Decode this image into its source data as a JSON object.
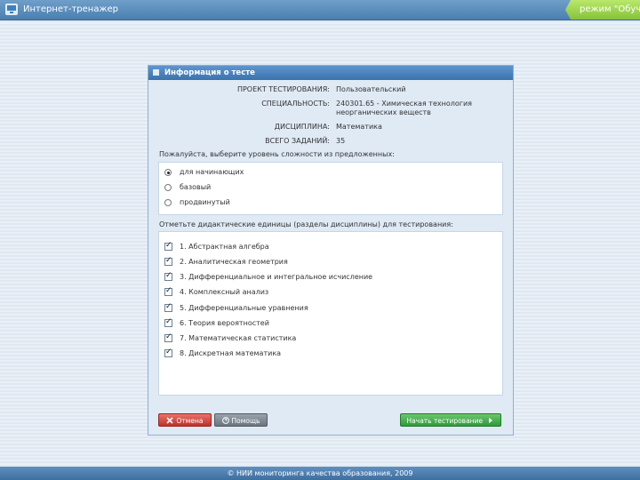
{
  "topbar": {
    "title": "Интернет-тренажер",
    "mode_label": "режим \"Обуче"
  },
  "dialog": {
    "title": "Информация о тесте",
    "info": [
      {
        "label": "ПРОЕКТ ТЕСТИРОВАНИЯ:",
        "value": "Пользовательский"
      },
      {
        "label": "СПЕЦИАЛЬНОСТЬ:",
        "value": "240301.65 - Химическая технология неорганических веществ"
      },
      {
        "label": "ДИСЦИПЛИНА:",
        "value": "Математика"
      },
      {
        "label": "ВСЕГО ЗАДАНИЙ:",
        "value": "35"
      }
    ],
    "level_prompt": "Пожалуйста, выберите уровень сложности из предложенных:",
    "levels": [
      {
        "label": "для начинающих",
        "selected": true
      },
      {
        "label": "базовый",
        "selected": false
      },
      {
        "label": "продвинутый",
        "selected": false
      }
    ],
    "units_prompt": "Отметьте дидактические единицы (разделы дисциплины) для тестирования:",
    "units": [
      {
        "label": "1. Абстрактная алгебра",
        "checked": true
      },
      {
        "label": "2. Аналитическая геометрия",
        "checked": true
      },
      {
        "label": "3. Дифференциальное и интегральное исчисление",
        "checked": true
      },
      {
        "label": "4. Комплексный анализ",
        "checked": true
      },
      {
        "label": "5. Дифференциальные уравнения",
        "checked": true
      },
      {
        "label": "6. Теория вероятностей",
        "checked": true
      },
      {
        "label": "7. Математическая статистика",
        "checked": true
      },
      {
        "label": "8. Дискретная математика",
        "checked": true
      }
    ],
    "buttons": {
      "cancel": "Отмена",
      "help": "Помощь",
      "start": "Начать тестирование"
    }
  },
  "footer": {
    "text": "© НИИ мониторинга качества образования, 2009"
  },
  "colors": {
    "accent_blue": "#3a72ad",
    "mode_green": "#86c23a",
    "cancel_red": "#c0322a",
    "start_green": "#2e9a3a"
  }
}
